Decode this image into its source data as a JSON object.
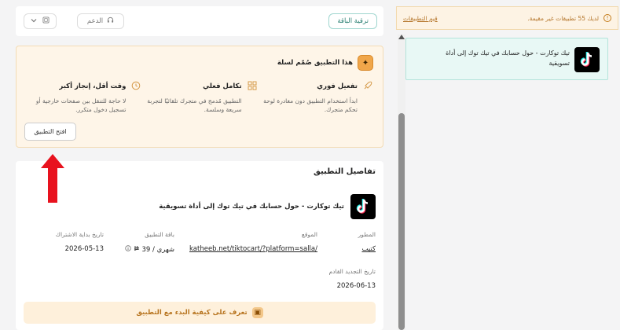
{
  "top_bar": {
    "upgrade_label": "ترقية الباقة",
    "support_label": "الدعم"
  },
  "feature_card": {
    "title": "هذا التطبيق صُمّم لسلة",
    "features": [
      {
        "title": "تفعيل فوري",
        "desc": "ابدأ استخدام التطبيق دون مغادرة لوحة تحكم متجرك.",
        "icon": "rocket-icon"
      },
      {
        "title": "تكامل فعلي",
        "desc": "التطبيق مُدمج في متجرك تلقائيًا لتجربة سريعة وسلسة.",
        "icon": "grid-icon"
      },
      {
        "title": "وقت أقل، إنجاز أكبر",
        "desc": "لا حاجة للتنقل بين صفحات خارجية أو تسجيل دخول متكرر.",
        "icon": "clock-icon"
      }
    ],
    "open_app_label": "افتح التطبيق"
  },
  "details": {
    "title": "تفاصيل التطبيق",
    "app_name": "تيك توكارت - حول حسابك في تيك توك إلى أداة تسويقية",
    "developer_label": "المطور",
    "developer": "كتيب",
    "site_label": "الموقع",
    "site": "katheeb.net/tiktocart/?platform=salla/",
    "plan_label": "باقة التطبيق",
    "plan": "شهري / 39",
    "start_label": "تاريخ بداية الاشتراك",
    "start_date": "2026-05-13",
    "renew_label": "تاريخ التجديد القادم",
    "renew_date": "2026-06-13",
    "guide_label": "تعرف على كيفية البدء مع التطبيق"
  },
  "sidebar": {
    "warning_text": "لديك 55 تطبيقات غير مقيمة.",
    "warning_link": "قيم التطبيقات",
    "app_card_text": "تيك توكارت - حول حسابك في تيك توك إلى أداة تسويقية"
  },
  "colors": {
    "accent": "#f0a64a",
    "teal": "#2a7f72",
    "arrow": "#e8121e"
  }
}
